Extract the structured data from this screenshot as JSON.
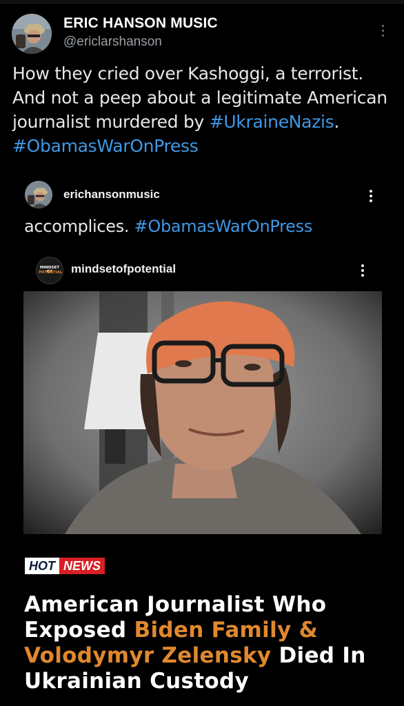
{
  "post": {
    "author_name": "ERIC HANSON MUSIC",
    "author_handle": "@ericlarshanson",
    "text_part1": "How they cried over Kashoggi, a terrorist. And not a peep about a legitimate American journalist murdered by ",
    "hashtag1": "#UkraineNazis",
    "text_part2": ".",
    "hashtag2": "#ObamasWarOnPress"
  },
  "embedded_post": {
    "username": "erichansonmusic",
    "caption_text": "accomplices. ",
    "caption_hashtag": "#ObamasWarOnPress"
  },
  "shared_reel": {
    "username": "mindsetofpotential",
    "avatar_logo_line1": "MINDSET OF",
    "avatar_logo_line2": "POTENTIAL",
    "badge_hot": "HOT",
    "badge_news": "NEWS",
    "headline_part1": "American Journalist Who Exposed ",
    "headline_highlight": "Biden Family & Volodymyr Zelensky",
    "headline_part2": " Died In Ukrainian Custody",
    "highlight_color": "#e0882e",
    "hashtag_color": "#3f98e6"
  },
  "icons": {
    "post_more": "vertical-ellipsis-icon",
    "embedded_more": "vertical-ellipsis-icon",
    "reel_more": "vertical-ellipsis-icon"
  }
}
